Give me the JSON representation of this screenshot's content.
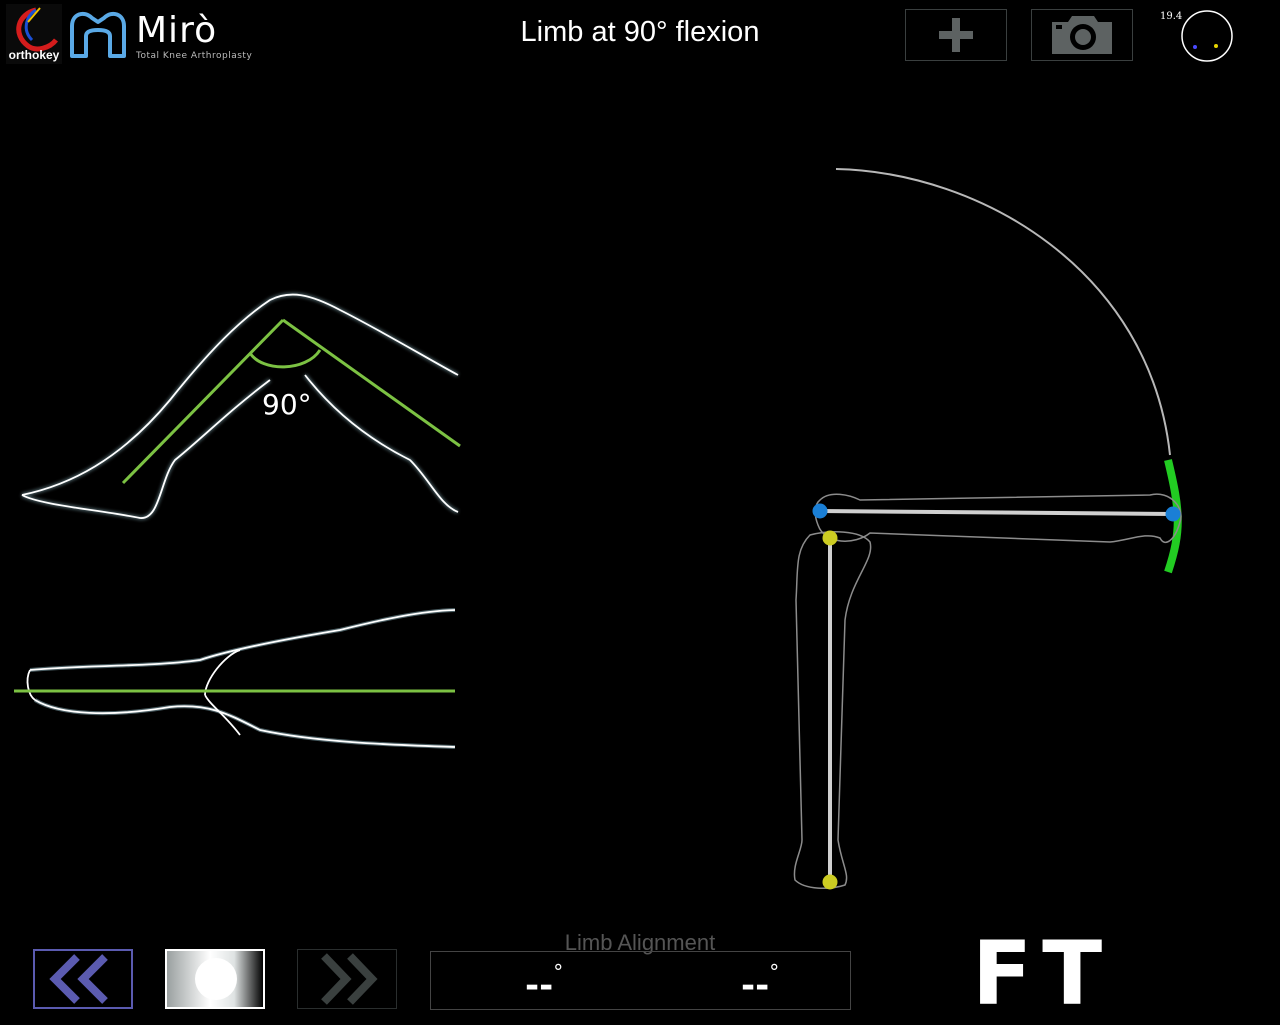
{
  "header": {
    "brand_logo_text": "orthokey",
    "app_name": "Mirò",
    "app_subtitle": "Total Knee Arthroplasty",
    "title": "Limb at 90° flexion",
    "fps": "19.4"
  },
  "icons": {
    "add": "plus-icon",
    "camera": "camera-icon",
    "back": "double-chevron-left-icon",
    "next": "double-chevron-right-icon",
    "record": "record-dot-icon"
  },
  "diagram": {
    "angle_label": "90°"
  },
  "footer": {
    "alignment_label": "Limb Alignment",
    "left_value": "--",
    "right_value": "--",
    "degree_symbol": "°",
    "mode": "FT"
  },
  "colors": {
    "accent_green": "#7cc243",
    "arc_green": "#22cc22",
    "marker_blue": "#1a7fd6",
    "marker_yellow": "#cccc22",
    "back_border": "#5b5bb0"
  }
}
